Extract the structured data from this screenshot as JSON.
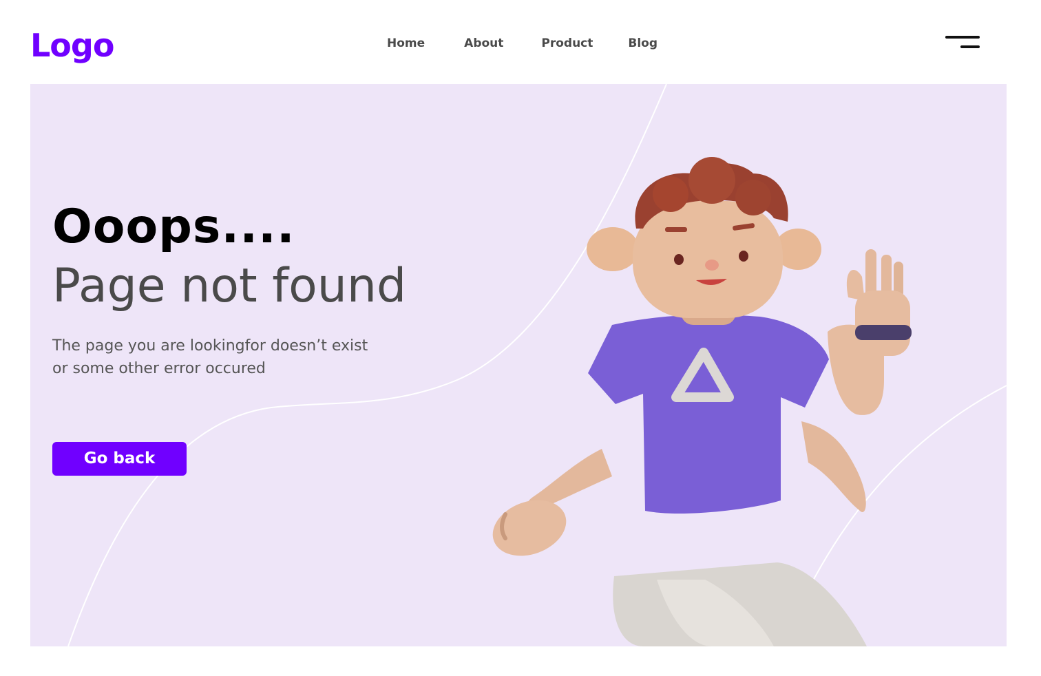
{
  "header": {
    "logo": "Logo",
    "nav": [
      {
        "label": "Home"
      },
      {
        "label": "About"
      },
      {
        "label": "Product"
      },
      {
        "label": "Blog"
      }
    ],
    "menu_icon": "hamburger-menu-icon"
  },
  "hero": {
    "title": "Ooops....",
    "subtitle": "Page not found",
    "description": "The page you are lookingfor doesn’t exist\n or some other error occured",
    "button_label": "Go back",
    "illustration": "3d-character-waving"
  },
  "colors": {
    "brand": "#7000ff",
    "hero_background": "#eee5f8",
    "shirt": "#7a5fd6",
    "text_dark": "#000000",
    "text_gray": "#4a4a4a"
  }
}
